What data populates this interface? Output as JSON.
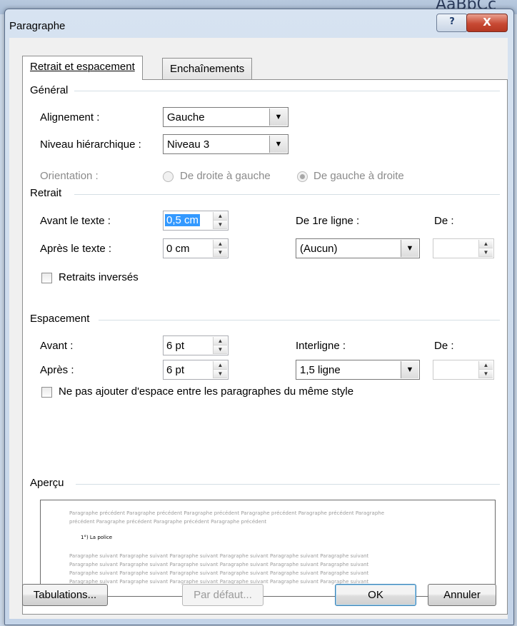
{
  "background": {
    "ribbon_fragment": "AaBbCc AaBbCc"
  },
  "window": {
    "title": "Paragraphe",
    "help_glyph": "?",
    "close_glyph": "X"
  },
  "tabs": [
    {
      "label": "Retrait et espacement",
      "active": true
    },
    {
      "label": "Enchaînements",
      "active": false
    }
  ],
  "general": {
    "heading": "Général",
    "alignment": {
      "label": "Alignement :",
      "value": "Gauche"
    },
    "level": {
      "label": "Niveau hiérarchique :",
      "value": "Niveau 3"
    },
    "orientation": {
      "label": "Orientation :",
      "options": [
        "De droite à gauche",
        "De gauche à droite"
      ],
      "selected": "De gauche à droite",
      "enabled": false
    }
  },
  "indent": {
    "heading": "Retrait",
    "before": {
      "label": "Avant le texte :",
      "value": "0,5 cm"
    },
    "after": {
      "label": "Après le texte :",
      "value": "0 cm"
    },
    "first_line": {
      "label": "De 1re ligne :",
      "value": "(Aucun)"
    },
    "by": {
      "label": "De :",
      "value": ""
    },
    "mirror": {
      "label": "Retraits inversés",
      "checked": false
    }
  },
  "spacing": {
    "heading": "Espacement",
    "before": {
      "label": "Avant :",
      "value": "6 pt"
    },
    "after": {
      "label": "Après :",
      "value": "6 pt"
    },
    "line_spacing": {
      "label": "Interligne :",
      "value": "1,5 ligne"
    },
    "at": {
      "label": "De :",
      "value": ""
    },
    "no_space": {
      "label": "Ne pas ajouter d'espace entre les paragraphes du même style",
      "checked": false
    }
  },
  "preview": {
    "heading": "Aperçu",
    "previous_1": "Paragraphe précédent Paragraphe précédent Paragraphe précédent Paragraphe précédent Paragraphe précédent Paragraphe",
    "previous_2": "précédent Paragraphe précédent Paragraphe précédent Paragraphe précédent",
    "current": "1°) La police",
    "following": "Paragraphe suivant Paragraphe suivant Paragraphe suivant Paragraphe suivant Paragraphe suivant Paragraphe suivant"
  },
  "buttons": {
    "tabs": "Tabulations...",
    "default": "Par défaut...",
    "ok": "OK",
    "cancel": "Annuler"
  },
  "colors": {
    "frame": "#c9d6e6",
    "close": "#c84a34",
    "selection": "#3399ff",
    "ok_border": "#3c7fb1"
  }
}
